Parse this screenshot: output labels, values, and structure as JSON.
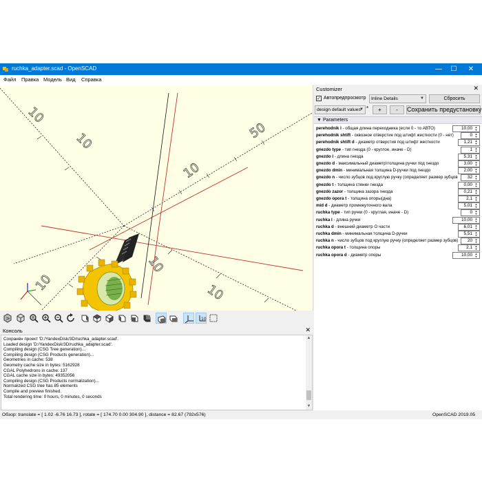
{
  "window": {
    "title": "ruchka_adapter.scad - OpenSCAD",
    "controls": [
      "minimize",
      "maximize",
      "close"
    ]
  },
  "menu": [
    "Файл",
    "Правка",
    "Модель",
    "Вид",
    "Справка"
  ],
  "viewport": {
    "axis_labels": [
      "50",
      "10",
      "10",
      "10",
      "10",
      "10",
      "10"
    ],
    "background": "#ffffe5",
    "model_color": "#f5c400"
  },
  "view_toolbar": {
    "buttons": [
      "preview",
      "render",
      "view-all",
      "zoom-in",
      "zoom-out",
      "reset-view",
      "view-right",
      "view-top",
      "view-bottom",
      "view-left",
      "view-front",
      "view-back",
      "perspective",
      "orthogonal",
      "show-axes",
      "show-scale-markers",
      "show-edges"
    ]
  },
  "console": {
    "title": "Консоль",
    "lines": [
      "Сохранён проект 'D:/YandexDisk/3D/ruchka_adapter.scad'.",
      "Loaded design 'D:/YandexDisk/3D/ruchka_adapter.scad'.",
      "Compiling design (CSG Tree generation)...",
      "Compiling design (CSG Products generation)...",
      "Geometries in cache: 538",
      "Geometry cache size in bytes: 5162928",
      "CGAL Polyhedrons in cache: 137",
      "CGAL cache size in bytes: 49352056",
      "Compiling design (CSG Products normalization)...",
      "Normalized CSG tree has 85 elements",
      "Compile and preview finished.",
      "Total rendering time: 0 hours, 0 minutes, 0 seconds"
    ]
  },
  "status": {
    "left": "Обзор: translate = [ 1.02 -6.76 16.73 ], rotate = [ 174.70 0.00 304.90 ], distance = 82.67 (792x576)",
    "right": "OpenSCAD 2019.05"
  },
  "customizer": {
    "title": "Customizer",
    "auto_preview_label": "Автопредпросмотр",
    "auto_preview_checked": true,
    "details_select": "Inline Details",
    "reset_label": "Сбросить",
    "preset_select": "design default values",
    "preset_modified_marker": "*",
    "add_label": "+",
    "remove_label": "-",
    "save_preset_label": "Сохранить предустановку",
    "section_title": "Parameters",
    "params": [
      {
        "name": "perehodnik l",
        "desc": " - общая длина переходника (если 0 - то АВТО)",
        "value": "10,00"
      },
      {
        "name": "perehodnik shtift",
        "desc": " - сквозное отверстие под штифт жесткости (0 - нет)",
        "value": "0"
      },
      {
        "name": "perehodnik shtift d",
        "desc": " - диаметр отверстия под штифт жесткости",
        "value": "1,21"
      },
      {
        "name": "gnezdo type",
        "desc": " - тип гнезда (0 - круглое, иначе - D)",
        "value": "1"
      },
      {
        "name": "gnezdo l",
        "desc": " - длина гнезда",
        "value": "5,31"
      },
      {
        "name": "gnezdo d",
        "desc": " - максимальный диаметр\\толщина ручки под гнездо",
        "value": "3,00"
      },
      {
        "name": "gnezdo dmin",
        "desc": " - минимальная толщина D-ручки под гнездо",
        "value": "2,00"
      },
      {
        "name": "gnezdo n",
        "desc": " - число зубцов под круглую ручку (определяет размер зубцов)",
        "value": "32"
      },
      {
        "name": "gnezdo t",
        "desc": " - толщина стенки гнезда",
        "value": "0,00"
      },
      {
        "name": "gnezdo zazor",
        "desc": " - толщина зазора гнезда",
        "value": "0,21"
      },
      {
        "name": "gnezdo opora t",
        "desc": " - толщина опоры(дна)",
        "value": "2,1"
      },
      {
        "name": "mid d",
        "desc": " - диаметр промежуточного вала",
        "value": "5,01"
      },
      {
        "name": "ruchka type",
        "desc": " - тип ручки (0 - круглая, иначе - D)",
        "value": "0"
      },
      {
        "name": "ruchka l",
        "desc": " - длина ручки",
        "value": "10,00"
      },
      {
        "name": "ruchka d",
        "desc": " - внешний диаметр О части",
        "value": "6,01"
      },
      {
        "name": "ruchka dmin",
        "desc": " - минимальная толщина D-ручки",
        "value": "5,51"
      },
      {
        "name": "ruchka n",
        "desc": " - число зубцов под круглую ручку (определяет размер зубцов)",
        "value": "20"
      },
      {
        "name": "ruchka opora t",
        "desc": " - толщина опоры",
        "value": "2,1"
      },
      {
        "name": "ruchka opora d",
        "desc": " - диаметр опоры",
        "value": "10,00"
      }
    ]
  }
}
